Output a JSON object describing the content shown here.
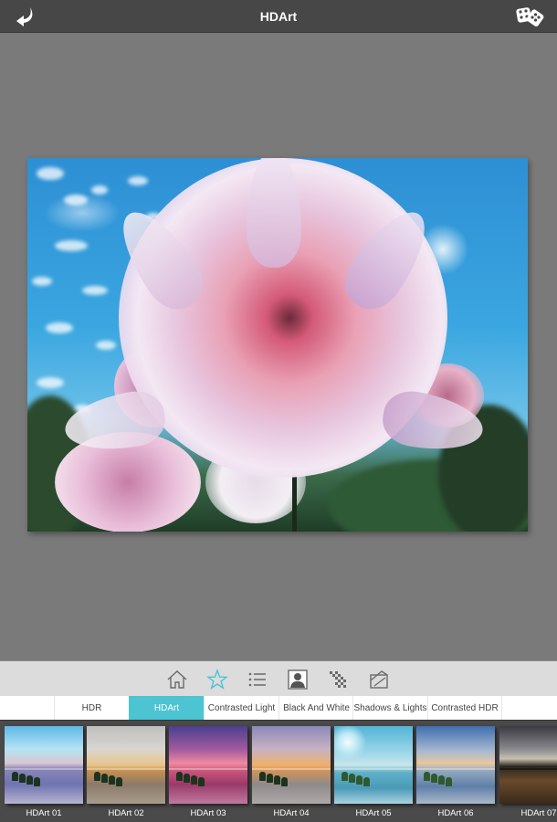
{
  "header": {
    "title": "HDArt",
    "back_icon": "back-arrow-icon",
    "random_icon": "dice-icon"
  },
  "toolbar": {
    "tools": [
      {
        "name": "home",
        "icon": "home-icon",
        "active": false
      },
      {
        "name": "favorites",
        "icon": "star-icon",
        "active": true
      },
      {
        "name": "list",
        "icon": "list-icon",
        "active": false
      },
      {
        "name": "portrait",
        "icon": "portrait-icon",
        "active": false
      },
      {
        "name": "texture",
        "icon": "checker-pattern-icon",
        "active": false
      },
      {
        "name": "frame",
        "icon": "frame-icon",
        "active": false
      }
    ],
    "accent_color": "#4cc4d2"
  },
  "tabs": [
    {
      "label": "HDR",
      "active": false
    },
    {
      "label": "HDArt",
      "active": true
    },
    {
      "label": "Contrasted Light",
      "active": false
    },
    {
      "label": "Black And White",
      "active": false
    },
    {
      "label": "Shadows & Lights",
      "active": false
    },
    {
      "label": "Contrasted HDR",
      "active": false
    }
  ],
  "presets": [
    {
      "label": "HDArt 01"
    },
    {
      "label": "HDArt 02"
    },
    {
      "label": "HDArt 03"
    },
    {
      "label": "HDArt 04"
    },
    {
      "label": "HDArt 05"
    },
    {
      "label": "HDArt 06"
    },
    {
      "label": "HDArt 07"
    }
  ],
  "photo": {
    "subject": "pink dahlia flower against blue sky with HDR art filter"
  }
}
